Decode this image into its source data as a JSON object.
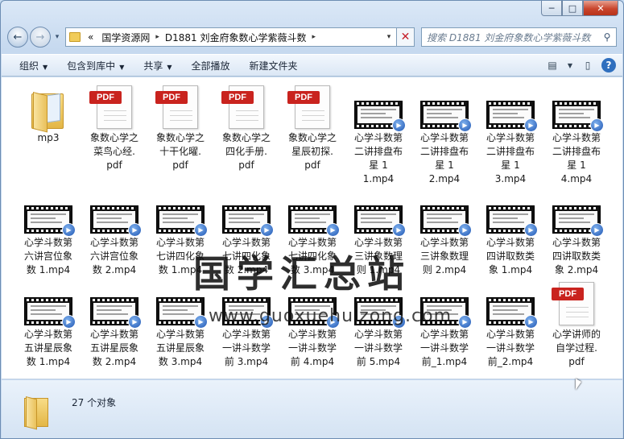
{
  "window": {
    "min_icon": "minimize-icon",
    "max_icon": "maximize-icon",
    "close_icon": "close-icon",
    "min_glyph": "─",
    "max_glyph": "□",
    "close_glyph": "✕"
  },
  "nav": {
    "back_glyph": "←",
    "forward_glyph": "→",
    "history_glyph": "▾",
    "breadcrumb_chevron": "«",
    "breadcrumb": [
      "国学资源网",
      "D1881 刘金府象数心学紫薇斗数"
    ],
    "crumb_sep": "▸",
    "addr_drop": "▾",
    "refresh_glyph": "✕",
    "search_placeholder": "搜索 D1881 刘金府象数心学紫薇斗数",
    "search_glyph": "⚲"
  },
  "toolbar": {
    "organize": "组织",
    "include": "包含到库中",
    "share": "共享",
    "play_all": "全部播放",
    "new_folder": "新建文件夹",
    "dropdown_glyph": "▼",
    "view_glyph": "▤",
    "pane_glyph": "▯",
    "help_glyph": "?"
  },
  "files": [
    {
      "name": "mp3",
      "type": "folder"
    },
    {
      "name": "象数心学之菜鸟心经.pdf",
      "type": "pdf"
    },
    {
      "name": "象数心学之十干化曜.pdf",
      "type": "pdf"
    },
    {
      "name": "象数心学之四化手册.pdf",
      "type": "pdf"
    },
    {
      "name": "象数心学之星辰初探.pdf",
      "type": "pdf"
    },
    {
      "name": "心学斗数第二讲排盘布星 1 1.mp4",
      "type": "mp4"
    },
    {
      "name": "心学斗数第二讲排盘布星 1 2.mp4",
      "type": "mp4"
    },
    {
      "name": "心学斗数第二讲排盘布星 1 3.mp4",
      "type": "mp4"
    },
    {
      "name": "心学斗数第二讲排盘布星 1 4.mp4",
      "type": "mp4"
    },
    {
      "name": "心学斗数第六讲宫位象数 1.mp4",
      "type": "mp4"
    },
    {
      "name": "心学斗数第六讲宫位象数 2.mp4",
      "type": "mp4"
    },
    {
      "name": "心学斗数第七讲四化象数 1.mp4",
      "type": "mp4"
    },
    {
      "name": "心学斗数第七讲四化象数 2.mp4",
      "type": "mp4"
    },
    {
      "name": "心学斗数第七讲四化象数 3.mp4",
      "type": "mp4"
    },
    {
      "name": "心学斗数第三讲象数理则 1.mp4",
      "type": "mp4"
    },
    {
      "name": "心学斗数第三讲象数理则 2.mp4",
      "type": "mp4"
    },
    {
      "name": "心学斗数第四讲取数类象 1.mp4",
      "type": "mp4"
    },
    {
      "name": "心学斗数第四讲取数类象 2.mp4",
      "type": "mp4"
    },
    {
      "name": "心学斗数第五讲星辰象数 1.mp4",
      "type": "mp4"
    },
    {
      "name": "心学斗数第五讲星辰象数 2.mp4",
      "type": "mp4"
    },
    {
      "name": "心学斗数第五讲星辰象数 3.mp4",
      "type": "mp4"
    },
    {
      "name": "心学斗数第一讲斗数学前 3.mp4",
      "type": "mp4"
    },
    {
      "name": "心学斗数第一讲斗数学前 4.mp4",
      "type": "mp4"
    },
    {
      "name": "心学斗数第一讲斗数学前 5.mp4",
      "type": "mp4"
    },
    {
      "name": "心学斗数第一讲斗数学前_1.mp4",
      "type": "mp4"
    },
    {
      "name": "心学斗数第一讲斗数学前_2.mp4",
      "type": "mp4"
    },
    {
      "name": "心学讲师的自学过程.pdf",
      "type": "pdf"
    }
  ],
  "file_labels": [
    "mp3",
    "象数心学之\n菜鸟心经.\npdf",
    "象数心学之\n十干化曜.\npdf",
    "象数心学之\n四化手册.\npdf",
    "象数心学之\n星辰初探.\npdf",
    "心学斗数第\n二讲排盘布\n星 1\n1.mp4",
    "心学斗数第\n二讲排盘布\n星 1\n2.mp4",
    "心学斗数第\n二讲排盘布\n星 1\n3.mp4",
    "心学斗数第\n二讲排盘布\n星 1\n4.mp4",
    "心学斗数第\n六讲宫位象\n数 1.mp4",
    "心学斗数第\n六讲宫位象\n数 2.mp4",
    "心学斗数第\n七讲四化象\n数 1.mp4",
    "心学斗数第\n七讲四化象\n数 2.mp4",
    "心学斗数第\n七讲四化象\n数 3.mp4",
    "心学斗数第\n三讲象数理\n则 1.mp4",
    "心学斗数第\n三讲象数理\n则 2.mp4",
    "心学斗数第\n四讲取数类\n象 1.mp4",
    "心学斗数第\n四讲取数类\n象 2.mp4",
    "心学斗数第\n五讲星辰象\n数 1.mp4",
    "心学斗数第\n五讲星辰象\n数 2.mp4",
    "心学斗数第\n五讲星辰象\n数 3.mp4",
    "心学斗数第\n一讲斗数学\n前 3.mp4",
    "心学斗数第\n一讲斗数学\n前 4.mp4",
    "心学斗数第\n一讲斗数学\n前 5.mp4",
    "心学斗数第\n一讲斗数学\n前_1.mp4",
    "心学斗数第\n一讲斗数学\n前_2.mp4",
    "心学讲师的\n自学过程.\npdf"
  ],
  "pdf_badge": "PDF",
  "video_badge_glyph": "▶",
  "status": {
    "count_text": "27 个对象"
  },
  "watermark": {
    "text": "国学汇总站",
    "url": "www.guoxuehuizong.com"
  }
}
